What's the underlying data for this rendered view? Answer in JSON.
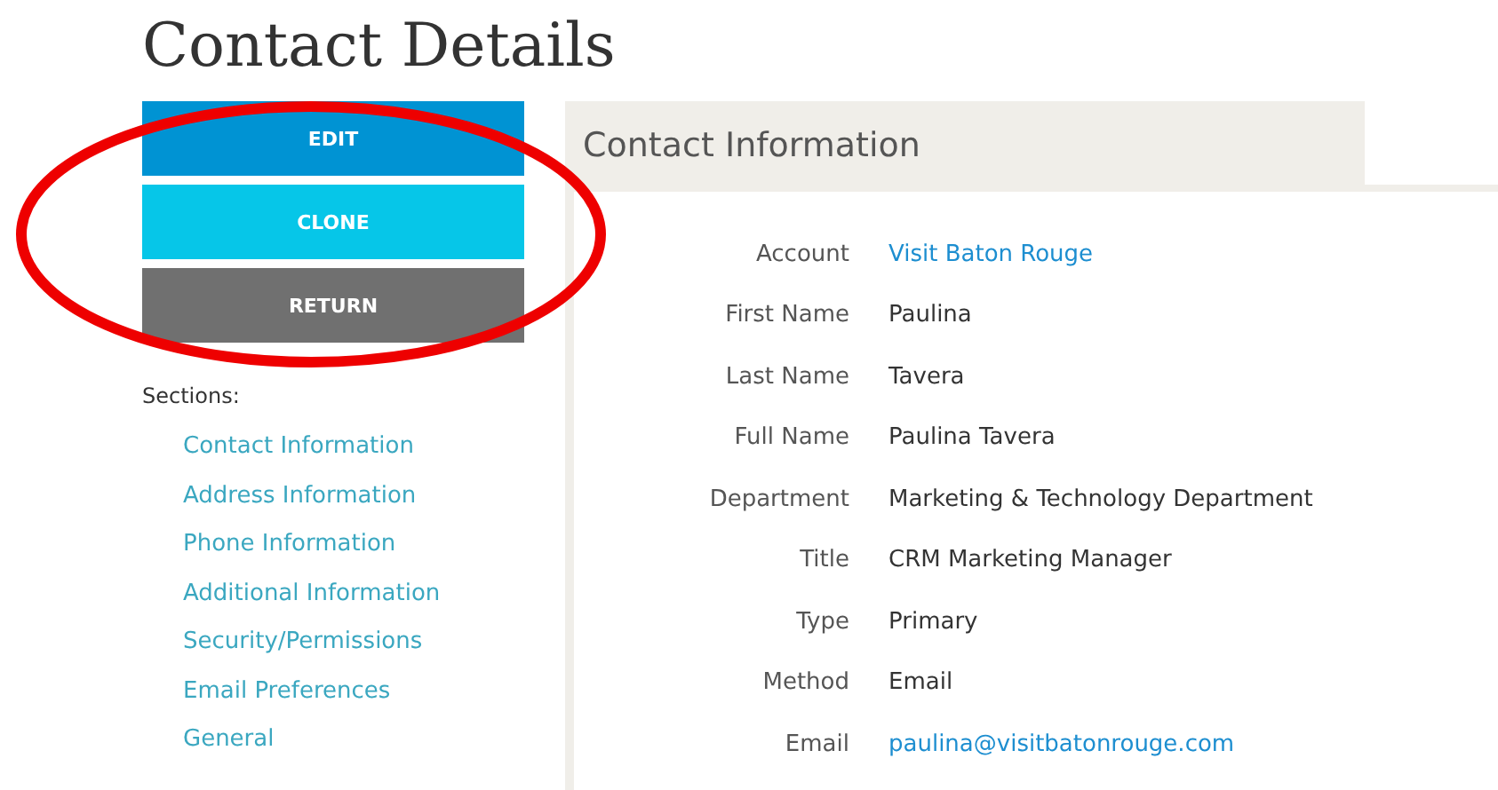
{
  "page_title": "Contact Details",
  "buttons": [
    {
      "label": "EDIT",
      "kind": "primary"
    },
    {
      "label": "CLONE",
      "kind": "secondary"
    },
    {
      "label": "RETURN",
      "kind": "neutral"
    }
  ],
  "sections": {
    "heading": "Sections:",
    "items": [
      "Contact Information",
      "Address Information",
      "Phone Information",
      "Additional Information",
      "Security/Permissions",
      "Email Preferences",
      "General"
    ]
  },
  "panel": {
    "tab": "Contact Information",
    "fields": [
      {
        "label": "Account",
        "value": "Visit Baton Rouge",
        "kind": "link"
      },
      {
        "label": "First Name",
        "value": "Paulina",
        "kind": "text"
      },
      {
        "label": "Last Name",
        "value": "Tavera",
        "kind": "text"
      },
      {
        "label": "Full Name",
        "value": "Paulina Tavera",
        "kind": "text"
      },
      {
        "label": "Department",
        "value": "Marketing & Technology Department",
        "kind": "text"
      },
      {
        "label": "Title",
        "value": "CRM Marketing Manager",
        "kind": "text"
      },
      {
        "label": "Type",
        "value": "Primary",
        "kind": "text"
      },
      {
        "label": "Method",
        "value": "Email",
        "kind": "text"
      },
      {
        "label": "Email",
        "value": "paulina@visitbatonrouge.com",
        "kind": "link"
      }
    ]
  }
}
